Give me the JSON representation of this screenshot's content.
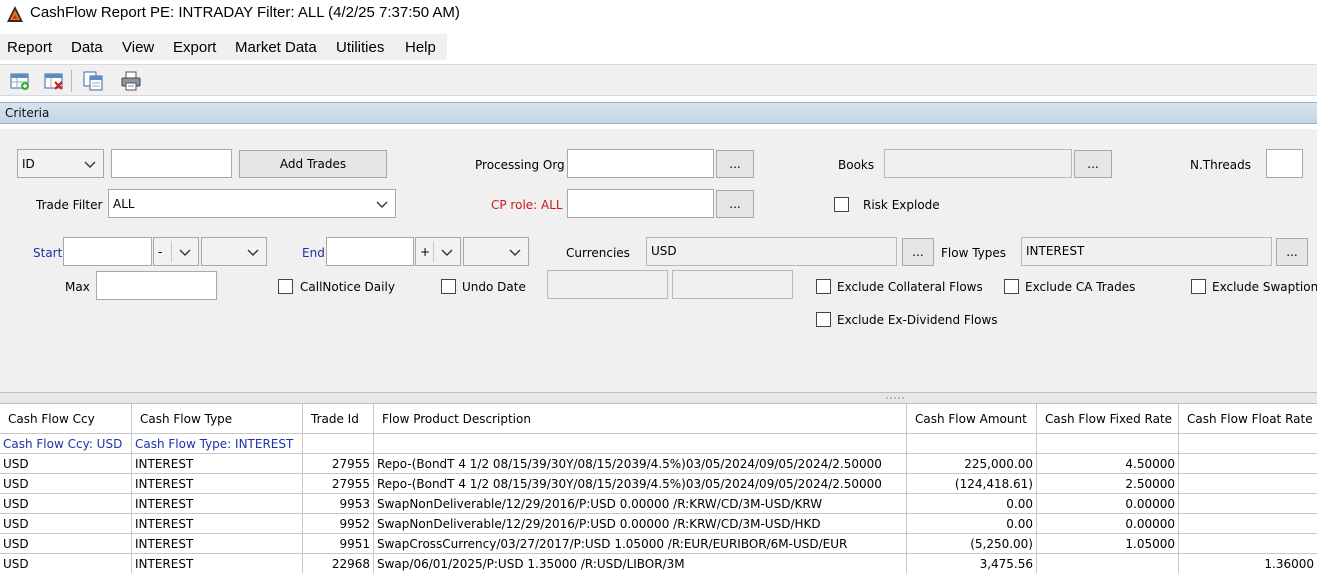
{
  "window": {
    "title": "CashFlow Report PE: INTRADAY Filter: ALL (4/2/25 7:37:50 AM)",
    "logo_icon": "app-logo-icon"
  },
  "menu": [
    "Report",
    "Data",
    "View",
    "Export",
    "Market Data",
    "Utilities",
    "Help"
  ],
  "toolbar": {
    "buttons": [
      "load-report-icon",
      "delete-report-icon",
      "copy-report-icon",
      "print-icon"
    ]
  },
  "criteria": {
    "header": "Criteria",
    "id_combo": "ID",
    "id_value": "",
    "add_trades": "Add Trades",
    "processing_org_label": "Processing Org",
    "processing_org_value": "",
    "ellipsis": "...",
    "books_label": "Books",
    "books_value": "",
    "nthreads_label": "N.Threads",
    "nthreads_value": "",
    "trade_filter_label": "Trade Filter",
    "trade_filter_value": "ALL",
    "cp_role_label": "CP role: ALL",
    "cp_role_value": "",
    "risk_explode": "Risk Explode",
    "start_label": "Start",
    "start_value": "",
    "start_sign": "-",
    "start_unit": "",
    "end_label": "End",
    "end_value": "",
    "end_sign": "+",
    "end_unit": "",
    "currencies_label": "Currencies",
    "currencies_value": "USD",
    "flow_types_label": "Flow Types",
    "flow_types_value": "INTEREST",
    "max_label": "Max",
    "max_value": "",
    "callnotice_daily": "CallNotice Daily",
    "undo_date": "Undo Date",
    "exclude_collateral": "Exclude Collateral Flows",
    "exclude_ca_trades": "Exclude CA Trades",
    "exclude_swaption": "Exclude Swaption",
    "exclude_exdividend": "Exclude Ex-Dividend Flows"
  },
  "table": {
    "columns": [
      "Cash Flow Ccy",
      "Cash Flow Type",
      "Trade Id",
      "Flow Product Description",
      "Cash Flow Amount",
      "Cash Flow Fixed Rate",
      "Cash Flow Float Rate"
    ],
    "group_row": [
      "Cash Flow Ccy: USD",
      "Cash Flow Type: INTEREST"
    ],
    "rows": [
      [
        "USD",
        "INTEREST",
        "27955",
        "Repo-(BondT 4 1/2 08/15/39/30Y/08/15/2039/4.5%)03/05/2024/09/05/2024/2.50000",
        "225,000.00",
        "4.50000",
        ""
      ],
      [
        "USD",
        "INTEREST",
        "27955",
        "Repo-(BondT 4 1/2 08/15/39/30Y/08/15/2039/4.5%)03/05/2024/09/05/2024/2.50000",
        "(124,418.61)",
        "2.50000",
        ""
      ],
      [
        "USD",
        "INTEREST",
        "9953",
        "SwapNonDeliverable/12/29/2016/P:USD 0.00000 /R:KRW/CD/3M-USD/KRW",
        "0.00",
        "0.00000",
        ""
      ],
      [
        "USD",
        "INTEREST",
        "9952",
        "SwapNonDeliverable/12/29/2016/P:USD 0.00000 /R:KRW/CD/3M-USD/HKD",
        "0.00",
        "0.00000",
        ""
      ],
      [
        "USD",
        "INTEREST",
        "9951",
        "SwapCrossCurrency/03/27/2017/P:USD 1.05000 /R:EUR/EURIBOR/6M-USD/EUR",
        "(5,250.00)",
        "1.05000",
        ""
      ],
      [
        "USD",
        "INTEREST",
        "22968",
        "Swap/06/01/2025/P:USD 1.35000 /R:USD/LIBOR/3M",
        "3,475.56",
        "",
        "1.36000"
      ]
    ]
  }
}
